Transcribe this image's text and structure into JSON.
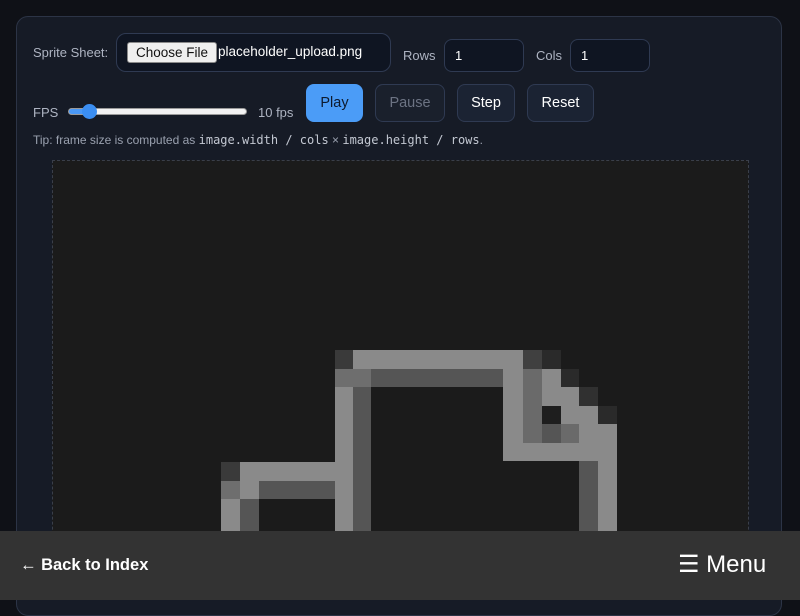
{
  "controls": {
    "sprite_sheet_label": "Sprite Sheet:",
    "choose_file_label": "Choose File",
    "file_name": "placeholder_upload.png",
    "rows_label": "Rows",
    "rows_value": "1",
    "cols_label": "Cols",
    "cols_value": "1",
    "fps_label": "FPS",
    "fps_value": 10,
    "fps_slider_fraction": 0.12,
    "fps_display": "10 fps"
  },
  "buttons": {
    "play": "Play",
    "pause": "Pause",
    "step": "Step",
    "reset": "Reset"
  },
  "tip": {
    "prefix": "Tip: frame size is computed as ",
    "code1": "image.width / cols",
    "times": " × ",
    "code2": "image.height / rows",
    "suffix": "."
  },
  "footer": {
    "back_label": "← Back to Index",
    "menu_label": "☰ Menu"
  },
  "colors": {
    "accent": "#4b9cf7",
    "panel": "#161b26",
    "footer": "#333333"
  }
}
